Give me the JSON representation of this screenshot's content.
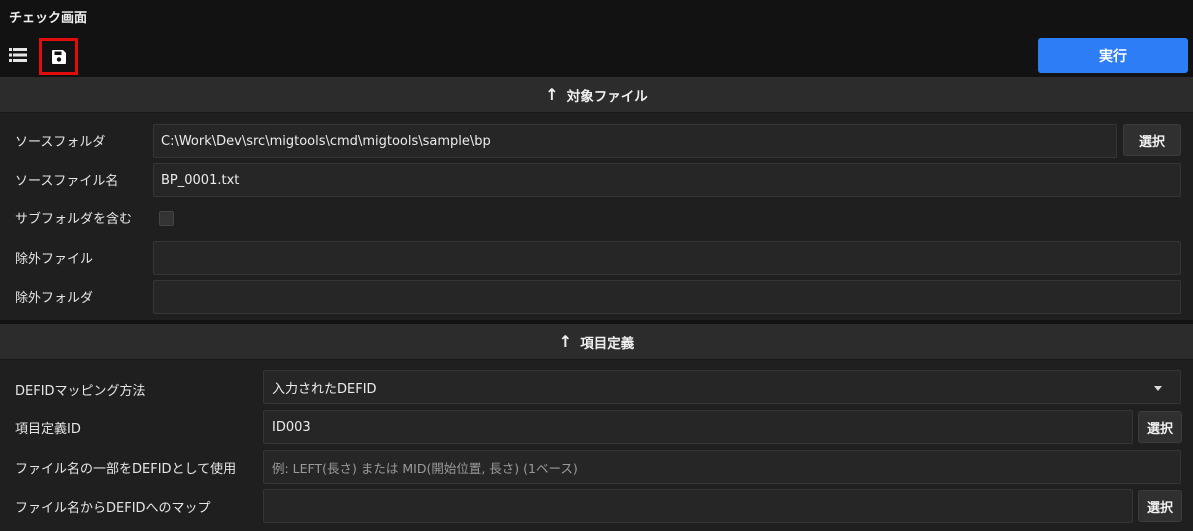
{
  "window": {
    "title": "チェック画面"
  },
  "toolbar": {
    "run_label": "実行",
    "list_icon": "list-icon",
    "save_icon": "save-icon"
  },
  "target_section": {
    "header": "対象ファイル",
    "source_folder": {
      "label": "ソースフォルダ",
      "value": "C:\\Work\\Dev\\src\\migtools\\cmd\\migtools\\sample\\bp",
      "button": "選択"
    },
    "source_file": {
      "label": "ソースファイル名",
      "value": "BP_0001.txt"
    },
    "include_subfolders": {
      "label": "サブフォルダを含む",
      "checked": false
    },
    "exclude_files": {
      "label": "除外ファイル",
      "value": ""
    },
    "exclude_folders": {
      "label": "除外フォルダ",
      "value": ""
    }
  },
  "definition_section": {
    "header": "項目定義",
    "defid_mapping": {
      "label": "DEFIDマッピング方法",
      "value": "入力されたDEFID"
    },
    "definition_id": {
      "label": "項目定義ID",
      "value": "ID003",
      "button": "選択"
    },
    "filename_part": {
      "label": "ファイル名の一部をDEFIDとして使用",
      "placeholder": "例: LEFT(長さ) または  MID(開始位置, 長さ) (1ベース)"
    },
    "filename_map": {
      "label": "ファイル名からDEFIDへのマップ",
      "value": "",
      "button": "選択"
    }
  }
}
